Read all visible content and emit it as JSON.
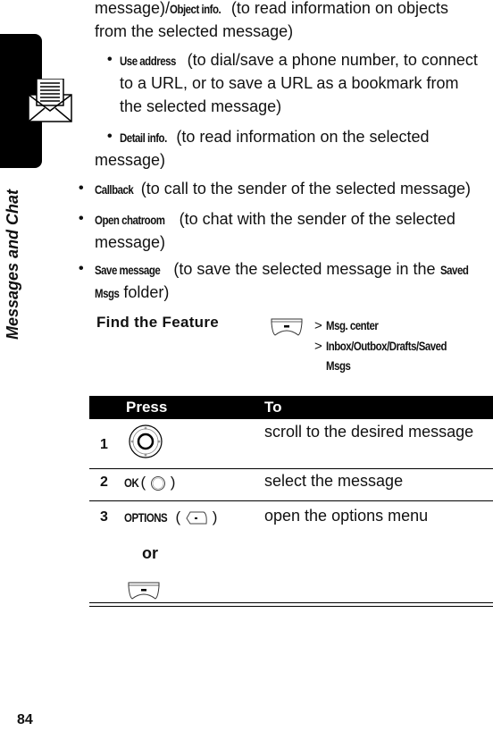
{
  "side": {
    "section_label": "Messages and Chat",
    "page_number": "84",
    "icon": "envelope-letter-icon"
  },
  "body": {
    "line1_prefix": "message)/",
    "line1_kw": "Object info.",
    "line1_rest": " (to read information on objects",
    "line2": "from the selected message)",
    "sub_bullets": [
      {
        "kw": "Use address",
        "text_a": " (to dial/save a phone number, to connect",
        "text_b": "to a URL, or to save a URL as a bookmark from",
        "text_c": "the selected message)"
      },
      {
        "kw": "Detail info.",
        "text_a": " (to read information on the selected",
        "text_b": "message)"
      }
    ],
    "bullets": [
      {
        "kw": "Callback",
        "text_a": " (to call to the sender of the selected message)"
      },
      {
        "kw": "Open chatroom",
        "text_a": " (to chat with the sender of the selected",
        "text_b": "message)"
      },
      {
        "kw": "Save message",
        "text_a": " (to save the selected message in the ",
        "kw2": "Saved",
        "kw3": "Msgs",
        "text_b": " folder)"
      }
    ],
    "bullet_char": "•"
  },
  "find_feature": {
    "title": "Find the Feature",
    "icon": "menu-key-icon",
    "arrow": ">",
    "path": [
      "Msg. center",
      "Inbox/Outbox/Drafts/Saved",
      "Msgs"
    ]
  },
  "table": {
    "headers": {
      "press": "Press",
      "to": "To"
    },
    "rows": [
      {
        "num": "1",
        "press_icon": "nav-key-icon",
        "to": "scroll to the desired message"
      },
      {
        "num": "2",
        "press_kw": "OK",
        "press_icon": "center-select-key-icon",
        "to": "select the message"
      },
      {
        "num": "3",
        "press_kw": "OPTIONS",
        "press_icon": "right-soft-key-icon",
        "or": "or",
        "alt_icon": "menu-key-icon",
        "to": "open the options menu"
      }
    ],
    "paren_open": "(",
    "paren_close": ")"
  }
}
